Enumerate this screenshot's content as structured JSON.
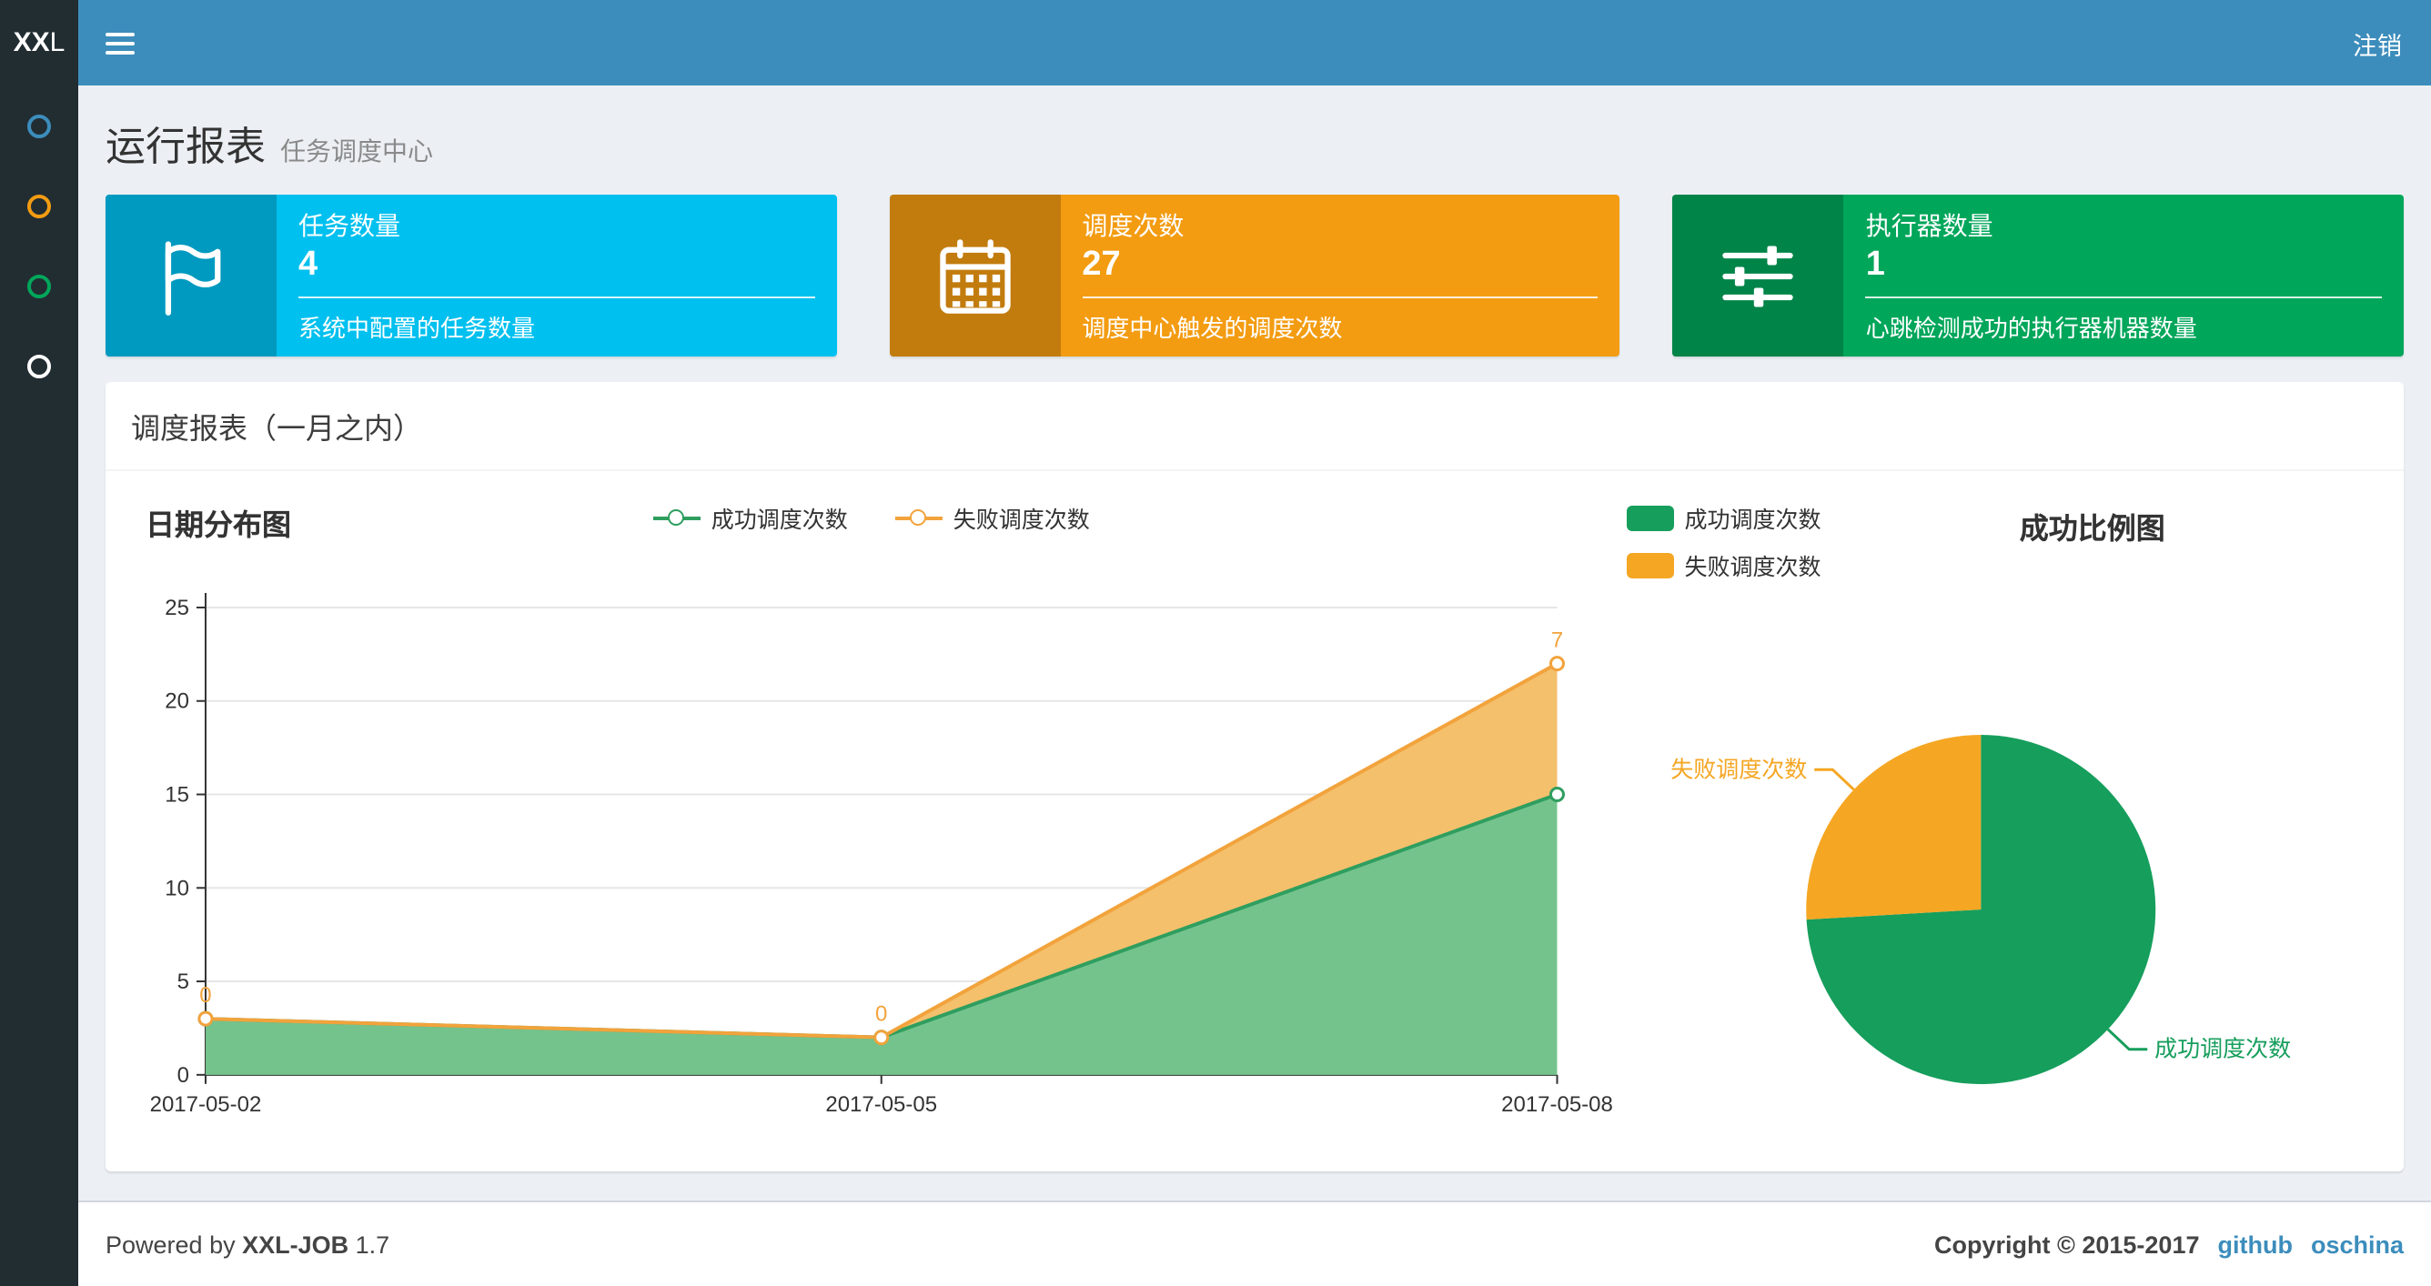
{
  "navbar": {
    "logo_bold": "XX",
    "logo_light": "L",
    "logout_label": "注销",
    "bg_color": "#3c8dbc",
    "logo_bg_color": "#222d32"
  },
  "sidebar": {
    "bg_color": "#222d32",
    "menu_icon_colors": [
      "#3c8dbc",
      "#f39c12",
      "#00a65a",
      "#ffffff"
    ]
  },
  "header": {
    "title": "运行报表",
    "subtitle": "任务调度中心"
  },
  "info_boxes": [
    {
      "label": "任务数量",
      "value": "4",
      "description": "系统中配置的任务数量",
      "color": "#00c0ef",
      "icon": "flag-icon"
    },
    {
      "label": "调度次数",
      "value": "27",
      "description": "调度中心触发的调度次数",
      "color": "#f39c12",
      "icon": "calendar-icon"
    },
    {
      "label": "执行器数量",
      "value": "1",
      "description": "心跳检测成功的执行器机器数量",
      "color": "#00a65a",
      "icon": "sliders-icon"
    }
  ],
  "panel": {
    "title": "调度报表（一月之内）"
  },
  "chart_data": [
    {
      "type": "area",
      "title": "日期分布图",
      "categories": [
        "2017-05-02",
        "2017-05-05",
        "2017-05-08"
      ],
      "series": [
        {
          "name": "成功调度次数",
          "values": [
            3,
            2,
            15
          ],
          "line_color": "#2f9e5f",
          "fill_color": "#74c38d"
        },
        {
          "name": "失败调度次数",
          "values": [
            0,
            0,
            7
          ],
          "line_color": "#f2a33c",
          "fill_color": "#f4c06c"
        }
      ],
      "stacked": true,
      "point_labels": [
        "0",
        "0",
        "7"
      ],
      "ylim": [
        0,
        25
      ],
      "y_ticks": [
        0,
        5,
        10,
        15,
        20,
        25
      ],
      "grid": true,
      "legend_position": "top-center"
    },
    {
      "type": "pie",
      "title": "成功比例图",
      "slices": [
        {
          "name": "成功调度次数",
          "value": 20,
          "color": "#169e5c"
        },
        {
          "name": "失败调度次数",
          "value": 7,
          "color": "#f5a623"
        }
      ],
      "legend_position": "top-left"
    }
  ],
  "footer": {
    "powered_prefix": "Powered by ",
    "product": "XXL-JOB",
    "version": "1.7",
    "copyright": "Copyright © 2015-2017",
    "links": [
      {
        "label": "github"
      },
      {
        "label": "oschina"
      }
    ],
    "link_color": "#3c8dbc"
  }
}
